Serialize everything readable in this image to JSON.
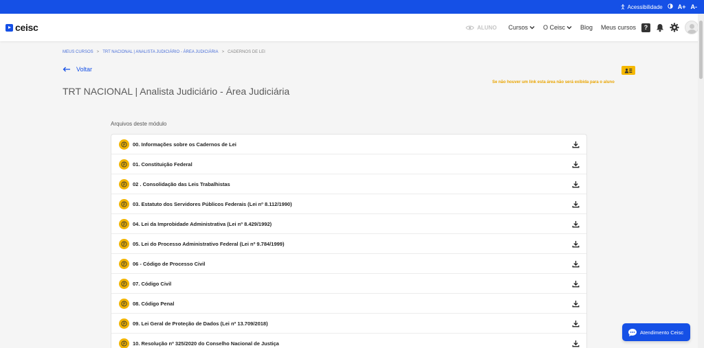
{
  "accessibility_bar": {
    "label": "Acessibilidade",
    "increase_font": "A+",
    "decrease_font": "A-"
  },
  "brand": {
    "name": "ceisc"
  },
  "nav": {
    "aluno_label": "ALUNO",
    "cursos": "Cursos",
    "o_ceisc": "O Ceisc",
    "blog": "Blog",
    "meus_cursos": "Meus cursos",
    "help_glyph": "?"
  },
  "breadcrumb": [
    "MEUS CURSOS",
    "TRT NACIONAL | ANALISTA JUDICIÁRIO - ÁREA JUDICIÁRIA",
    "CADERNOS DE LEI"
  ],
  "back_label": "Voltar",
  "page_title": "TRT NACIONAL | Analista Judiciário - Área Judiciária",
  "notice": "Se não houver um link esta área não será exibida para o aluno",
  "section_label": "Arquivos deste módulo",
  "files": [
    "00. Informações sobre os Cadernos de Lei",
    "01. Constituição Federal",
    "02 . Consolidação das Leis Trabalhistas",
    "03. Estatuto dos Servidores Públicos Federais (Lei nº 8.112/1990)",
    "04. Lei da Improbidade Administrativa (Lei nº 8.429/1992)",
    "05. Lei do Processo Administrativo Federal (Lei nº 9.784/1999)",
    "06 - Código de Processo Civil",
    "07. Código Civil",
    "08. Código Penal",
    "09. Lei Geral de Proteção de Dados (Lei nº 13.709/2018)",
    "10. Resolução nº 325/2020 do Conselho Nacional de Justiça"
  ],
  "chat_button": "Atendimento Ceisc",
  "colors": {
    "primary": "#1550e6",
    "accent": "#f2b400",
    "notice": "#e9a400"
  }
}
